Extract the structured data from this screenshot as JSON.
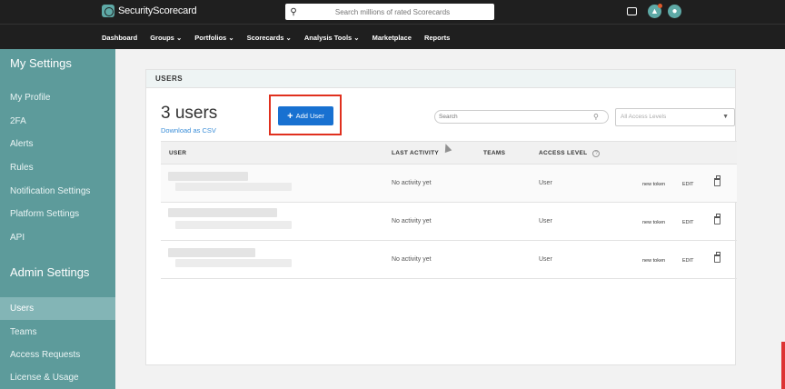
{
  "header": {
    "brand": "SecurityScorecard",
    "search_placeholder": "Search millions of rated Scorecards",
    "icons": [
      "search-icon",
      "chat-icon",
      "bell-icon",
      "user-avatar-icon"
    ]
  },
  "nav": {
    "items": [
      "Dashboard",
      "Groups ⌄",
      "Portfolios ⌄",
      "Scorecards ⌄",
      "Analysis Tools ⌄",
      "Marketplace",
      "Reports"
    ]
  },
  "sidebar": {
    "heading_my": "My Settings",
    "my_items": [
      "My Profile",
      "2FA",
      "Alerts",
      "Rules",
      "Notification Settings",
      "Platform Settings",
      "API"
    ],
    "heading_admin": "Admin Settings",
    "admin_items": [
      "Users",
      "Teams",
      "Access Requests",
      "License & Usage"
    ],
    "active": "Users"
  },
  "panel": {
    "title": "USERS",
    "count": "3 users",
    "csv_link": "Download as CSV",
    "add_button": "Add User",
    "search_placeholder": "Search",
    "access_select": "All Access Levels"
  },
  "table": {
    "headers": {
      "user": "USER",
      "activity": "LAST ACTIVITY",
      "teams": "TEAMS",
      "access": "ACCESS LEVEL"
    },
    "rows": [
      {
        "activity": "No activity yet",
        "access": "User",
        "token": "new token",
        "edit": "EDIT"
      },
      {
        "activity": "No activity yet",
        "access": "User",
        "token": "new token",
        "edit": "EDIT"
      },
      {
        "activity": "No activity yet",
        "access": "User",
        "token": "new token",
        "edit": "EDIT"
      }
    ]
  },
  "colors": {
    "header_bg": "#1f1f1f",
    "sidebar_bg": "#5d9b9b",
    "sidebar_active": "#83b5b6",
    "primary_button": "#1871d1",
    "highlight_outline": "#e0301e",
    "link": "#3b8ed8"
  }
}
